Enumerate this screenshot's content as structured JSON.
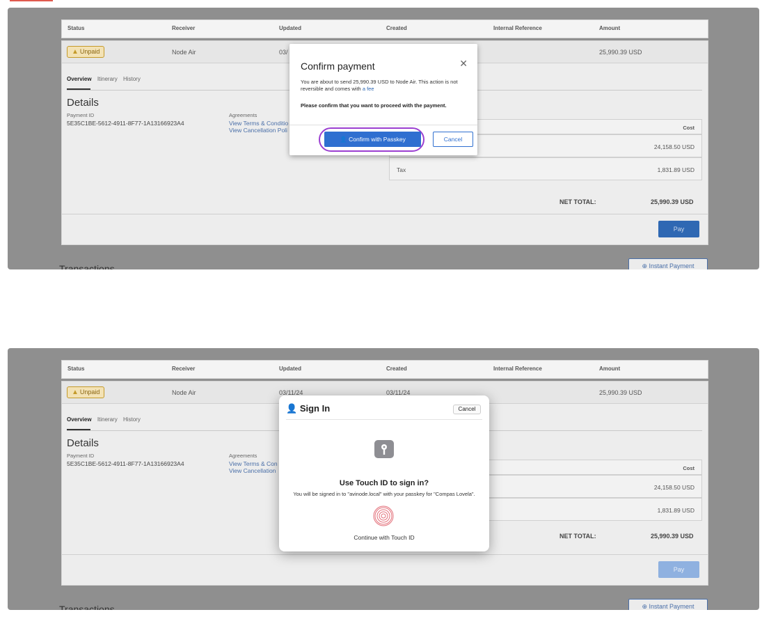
{
  "table": {
    "headers": [
      "Status",
      "Receiver",
      "Updated",
      "Created",
      "Internal Reference",
      "Amount"
    ],
    "status_badge": "Unpaid",
    "receiver": "Node Air",
    "updated": "03/11/24",
    "updated_partial": "03/",
    "created": "03/11/24",
    "amount": "25,990.39 USD"
  },
  "tabs": [
    "Overview",
    "Itinerary",
    "History"
  ],
  "details": {
    "title": "Details",
    "payment_id_label": "Payment ID",
    "payment_id": "5E35C1BE-5612-4911-8F77-1A13166923A4",
    "agreements_label": "Agreements",
    "terms_top": "View Terms & Conditio",
    "cancel_top": "View Cancellation Poli",
    "terms_bottom": "View Terms & Con",
    "cancel_bottom": "View Cancellation"
  },
  "costs": {
    "header": "Cost",
    "base": "24,158.50 USD",
    "tax_label": "Tax",
    "tax": "1,831.89 USD",
    "net_label": "NET TOTAL:",
    "net": "25,990.39 USD"
  },
  "pay_label": "Pay",
  "transactions_title": "Transactions",
  "instant_payment_label": "Instant Payment",
  "confirm_modal": {
    "title": "Confirm payment",
    "body": "You are about to send 25,990.39 USD to Node Air. This action is not reversible and comes with",
    "fee_link": "a fee",
    "prompt": "Please confirm that you want to proceed with the payment.",
    "confirm_label": "Confirm with Passkey",
    "cancel_label": "Cancel"
  },
  "signin_sheet": {
    "title": "Sign In",
    "cancel_label": "Cancel",
    "question": "Use Touch ID to sign in?",
    "description": "You will be signed in to \"avinode.local\" with your passkey for \"Compas Lovela\".",
    "continue_label": "Continue with Touch ID"
  },
  "colors": {
    "accent": "#2f6fd0",
    "highlight_ring": "#9b3fd1",
    "warning": "#c49a2a"
  }
}
